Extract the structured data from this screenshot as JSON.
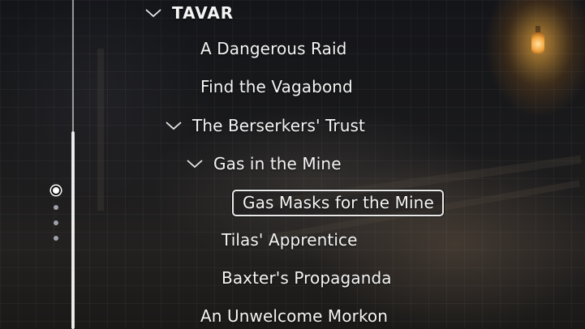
{
  "quest_log": {
    "region": {
      "label": "TAVAR",
      "expanded": true
    },
    "items": [
      {
        "label": "A Dangerous Raid",
        "level": 1,
        "expanded": null,
        "selected": false
      },
      {
        "label": "Find the Vagabond",
        "level": 1,
        "expanded": null,
        "selected": false
      },
      {
        "label": "The Berserkers' Trust",
        "level": 1,
        "expanded": true,
        "selected": false
      },
      {
        "label": "Gas in the Mine",
        "level": 2,
        "expanded": true,
        "selected": false
      },
      {
        "label": "Gas Masks for the Mine",
        "level": 3,
        "expanded": null,
        "selected": true
      },
      {
        "label": "Tilas' Apprentice",
        "level": 2,
        "expanded": null,
        "selected": false
      },
      {
        "label": "Baxter's Propaganda",
        "level": 2,
        "expanded": null,
        "selected": false
      },
      {
        "label": "An Unwelcome Morkon",
        "level": 1,
        "expanded": null,
        "selected": false
      }
    ]
  },
  "page_indicator": {
    "count": 4,
    "current": 1
  },
  "icons": {
    "expand": "chevron-down-icon"
  },
  "colors": {
    "text": "#f4f4f4",
    "selection_border": "#e8e8e8"
  }
}
